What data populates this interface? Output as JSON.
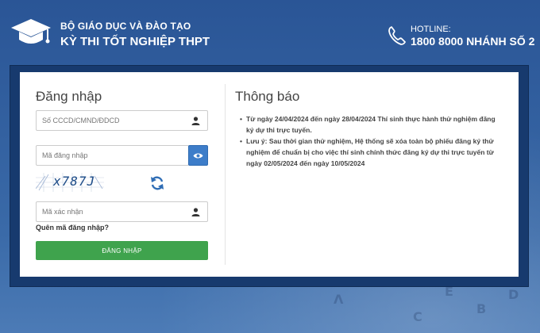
{
  "header": {
    "org": "BỘ GIÁO DỤC VÀ ĐÀO TẠO",
    "exam": "KỲ THI TỐT NGHIỆP THPT",
    "hotline_label": "HOTLINE:",
    "hotline_number": "1800 8000 NHÁNH SỐ 2",
    "logo_icon": "graduation-cap-icon",
    "phone_icon": "phone-icon"
  },
  "login": {
    "title": "Đăng nhập",
    "id_placeholder": "Số CCCD/CMND/ĐDCD",
    "password_placeholder": "Mã đăng nhập",
    "captcha_text": "x787J",
    "verify_placeholder": "Mã xác nhận",
    "forgot_label": "Quên mã đăng nhập?",
    "submit_label": "ĐĂNG NHẬP"
  },
  "notice": {
    "title": "Thông báo",
    "items": [
      "Từ ngày 24/04/2024 đến ngày 28/04/2024 Thí sinh thực hành thử nghiệm đăng ký dự thi trực tuyến.",
      "Lưu ý: Sau thời gian thử nghiệm, Hệ thống sẽ xóa toàn bộ phiếu đăng ký thử nghiệm để chuẩn bị cho việc thí sinh chính thức đăng ký dự thi trực tuyến từ ngày 02/05/2024 đến ngày 10/05/2024"
    ]
  },
  "colors": {
    "background": "#2f5d9c",
    "panel": "#173a6e",
    "button_green": "#3fa34d",
    "eye_blue": "#3d7dc9"
  }
}
